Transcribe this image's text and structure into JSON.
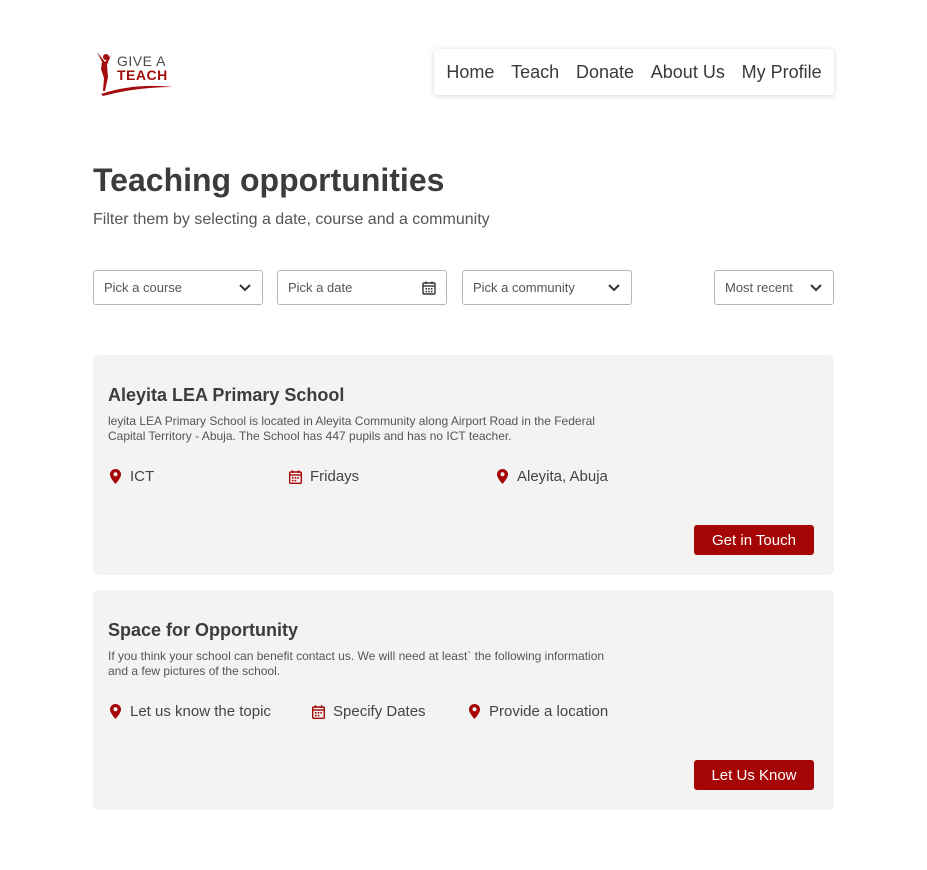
{
  "brand": {
    "line1": "GIVE A",
    "line2": "TEACH",
    "accent_color": "#a50505"
  },
  "nav": {
    "items": [
      {
        "label": "Home"
      },
      {
        "label": "Teach"
      },
      {
        "label": "Donate"
      },
      {
        "label": "About Us"
      },
      {
        "label": "My Profile"
      }
    ]
  },
  "header": {
    "title": "Teaching opportunities",
    "subtitle": "Filter them by selecting a date, course and a community"
  },
  "filters": {
    "course_placeholder": "Pick a course",
    "date_placeholder": "Pick a date",
    "community_placeholder": "Pick a community",
    "sort_value": "Most recent"
  },
  "cards": [
    {
      "title": "Aleyita LEA Primary School",
      "description": "leyita LEA Primary School is located in Aleyita Community along Airport Road in the Federal Capital Territory - Abuja. The School has 447 pupils and has no ICT teacher.",
      "course": "ICT",
      "schedule": "Fridays",
      "location": "Aleyita, Abuja",
      "button": "Get in Touch",
      "icons": [
        "location-pin-icon",
        "calendar-icon",
        "location-pin-icon"
      ]
    },
    {
      "title": "Space for Opportunity",
      "description": "If you think your school can benefit contact us. We will need at least` the following information and a few pictures of the school.",
      "course": "Let us know the topic",
      "schedule": "Specify Dates",
      "location": "Provide a location",
      "button": "Let Us Know",
      "icons": [
        "location-pin-icon",
        "calendar-icon",
        "location-pin-icon"
      ]
    }
  ]
}
